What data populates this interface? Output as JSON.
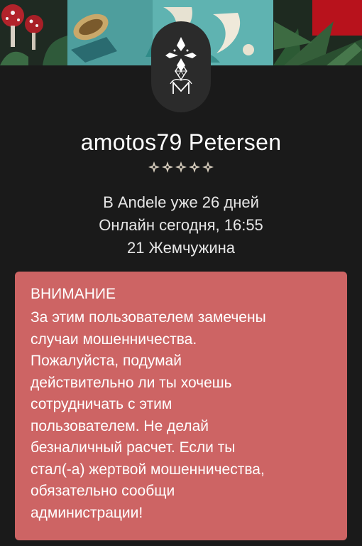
{
  "profile": {
    "name": "amotos79 Petersen",
    "rating": {
      "value": 5,
      "max": 5
    },
    "days_on_site": "В Andele уже 26 дней",
    "last_online": "Онлайн сегодня, 16:55",
    "pearls": "21 Жемчужина"
  },
  "warning": {
    "title": "ВНИМАНИЕ",
    "text": "За этим пользователем замечены\nслучаи мошенничества.\nПожалуйста, подумай\nдействительно ли ты хочешь\nсотрудничать с этим\nпользователем. Не делай\nбезналичный расчет. Если ты\nстал(-а) жертвой мошенничества,\nобязательно сообщи\nадминистрации!"
  },
  "icons": {
    "avatar": "andele-logo-icon",
    "rating_star": "star-icon"
  },
  "colors": {
    "background": "#1a1a1a",
    "warning_background": "#cd6464",
    "star": "#d9cfbf"
  }
}
